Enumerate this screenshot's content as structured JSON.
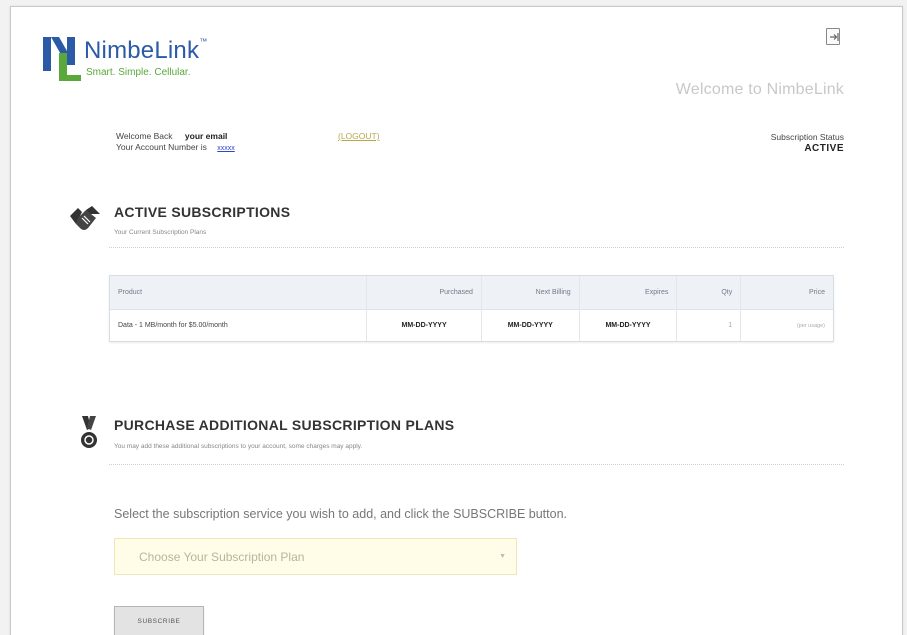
{
  "header": {
    "logo_name": "NimbeLink",
    "logo_tm": "™",
    "logo_tagline": "Smart. Simple. Cellular.",
    "welcome_title": "Welcome to NimbeLink"
  },
  "account": {
    "welcome_label": "Welcome Back",
    "email": "your email",
    "account_label": "Your Account Number is",
    "account_number": "xxxxx",
    "logout_label": "(LOGOUT)",
    "status_label": "Subscription Status",
    "status_value": "ACTIVE"
  },
  "active_section": {
    "title": "ACTIVE SUBSCRIPTIONS",
    "subtitle": "Your Current Subscription Plans",
    "columns": [
      "Product",
      "Purchased",
      "Next Billing",
      "Expires",
      "Qty",
      "Price"
    ],
    "rows": [
      {
        "product": "Data - 1 MB/month for $5.00/month",
        "purchased": "MM-DD-YYYY",
        "next_billing": "MM-DD-YYYY",
        "expires": "MM-DD-YYYY",
        "qty": "1",
        "price": "(per usage)"
      }
    ]
  },
  "purchase_section": {
    "title": "PURCHASE ADDITIONAL SUBSCRIPTION PLANS",
    "subtitle": "You may add these additional subscriptions to your account, some charges may apply.",
    "instruction": "Select the subscription service you wish to add, and click the SUBSCRIBE button.",
    "select_placeholder": "Choose Your Subscription Plan",
    "subscribe_label": "SUBSCRIBE"
  },
  "icons": {
    "logo": "nimbelink-logo-icon",
    "logout": "logout-icon",
    "active": "handshake-icon",
    "purchase": "medal-icon",
    "select_arrow": "chevron-down-icon"
  },
  "colors": {
    "brand_blue": "#2b5aa6",
    "brand_green": "#5aa83a",
    "select_bg": "#fffce8"
  }
}
